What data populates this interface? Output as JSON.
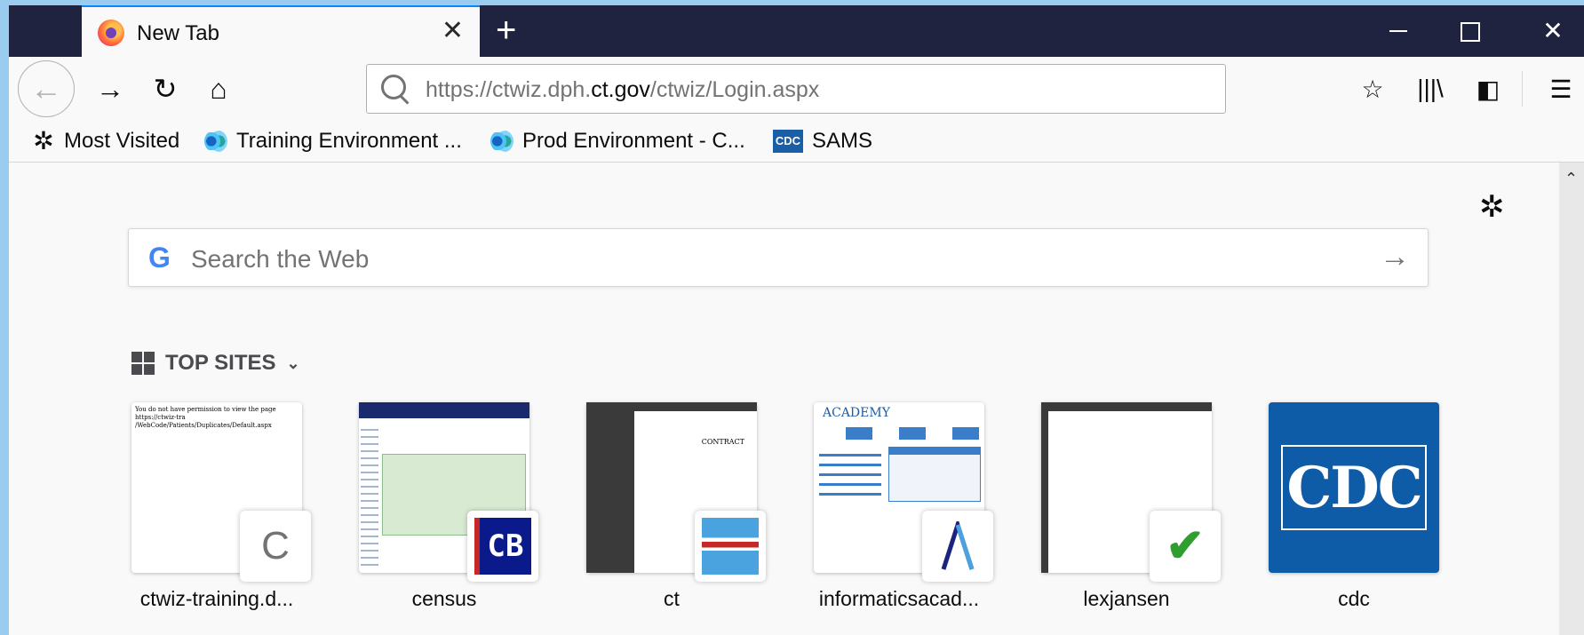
{
  "tab": {
    "title": "New Tab",
    "close_glyph": "✕"
  },
  "new_tab_glyph": "+",
  "window_controls": {
    "close_glyph": "✕"
  },
  "nav": {
    "back_glyph": "←",
    "forward_glyph": "→",
    "reload_glyph": "↻",
    "home_glyph": "⌂",
    "url_prefix": "https://ctwiz.dph.",
    "url_domain": "ct.gov",
    "url_suffix": "/ctwiz/Login.aspx",
    "star_glyph": "☆",
    "library_glyph": "|||\\",
    "sidebar_glyph": "◧",
    "menu_glyph": "☰"
  },
  "bookmarks": [
    {
      "label": "Most Visited",
      "icon": "gear-icon",
      "glyph": "✲"
    },
    {
      "label": "Training Environment ...",
      "icon": "site-icon"
    },
    {
      "label": "Prod Environment - C...",
      "icon": "site-icon"
    },
    {
      "label": "SAMS",
      "icon": "cdc-icon",
      "glyph": "CDC"
    }
  ],
  "search": {
    "placeholder": "Search the Web",
    "g_glyph": "G",
    "arrow_glyph": "→"
  },
  "settings_glyph": "✲",
  "top_sites": {
    "heading": "TOP SITES",
    "chevron": "⌄",
    "sites": [
      {
        "label": "ctwiz-training.d...",
        "fav": "C",
        "snippet": "You do not have permission to view the page https://ctwiz-tra /WebCode/Patients/Duplicates/Default.aspx"
      },
      {
        "label": "census",
        "fav": "CB"
      },
      {
        "label": "ct",
        "fav": "",
        "doc_text": "CONTRACT"
      },
      {
        "label": "informaticsacad...",
        "fav": "",
        "logo_text": "ACADEMY"
      },
      {
        "label": "lexjansen",
        "fav": "✔"
      },
      {
        "label": "cdc",
        "fav": "",
        "logo_text": "CDC"
      }
    ]
  },
  "scroll_up_glyph": "⌃"
}
